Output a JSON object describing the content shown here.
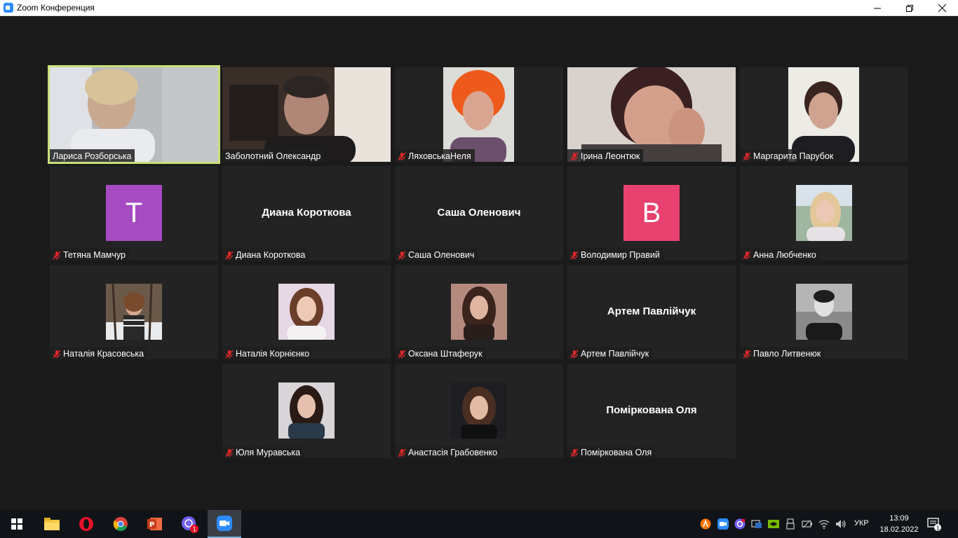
{
  "window": {
    "title": "Zoom Конференция"
  },
  "participants": [
    {
      "name": "Лариса Розборська",
      "muted": false,
      "type": "video"
    },
    {
      "name": "Заболотний Олександр",
      "muted": false,
      "type": "video"
    },
    {
      "name": "ЛяховськаНеля",
      "muted": true,
      "type": "video"
    },
    {
      "name": "Ірина Леонтюк",
      "muted": true,
      "type": "video"
    },
    {
      "name": "Маргарита Парубок",
      "muted": true,
      "type": "video"
    },
    {
      "name": "Тетяна Мамчур",
      "muted": true,
      "type": "avatar",
      "initial": "T",
      "color": "#a64bc2"
    },
    {
      "name": "Диана Короткова",
      "muted": true,
      "type": "text",
      "display": "Диана Короткова"
    },
    {
      "name": "Саша Оленович",
      "muted": true,
      "type": "text",
      "display": "Саша Оленович"
    },
    {
      "name": "Володимир Правий",
      "muted": true,
      "type": "avatar",
      "initial": "B",
      "color": "#e8416f"
    },
    {
      "name": "Анна Любченко",
      "muted": true,
      "type": "photo"
    },
    {
      "name": "Наталія Красовська",
      "muted": true,
      "type": "photo"
    },
    {
      "name": "Наталія Корнієнко",
      "muted": true,
      "type": "photo"
    },
    {
      "name": "Оксана Штаферук",
      "muted": true,
      "type": "photo"
    },
    {
      "name": "Артем Павлійчук",
      "muted": true,
      "type": "text",
      "display": "Артем Павлійчук"
    },
    {
      "name": "Павло Литвенюк",
      "muted": true,
      "type": "photo"
    },
    {
      "name": "Юля Муравська",
      "muted": true,
      "type": "photo"
    },
    {
      "name": "Анастасія Грабовенко",
      "muted": true,
      "type": "photo"
    },
    {
      "name": "Поміркована Оля",
      "muted": true,
      "type": "text",
      "display": "Поміркована Оля"
    }
  ],
  "taskbar": {
    "apps": [
      "windows-start",
      "file-explorer",
      "opera",
      "chrome",
      "powerpoint",
      "viber",
      "zoom"
    ],
    "viber_badge": "1",
    "language": "УКР",
    "time": "13:09",
    "date": "18.02.2022",
    "notification_badge": "1"
  }
}
